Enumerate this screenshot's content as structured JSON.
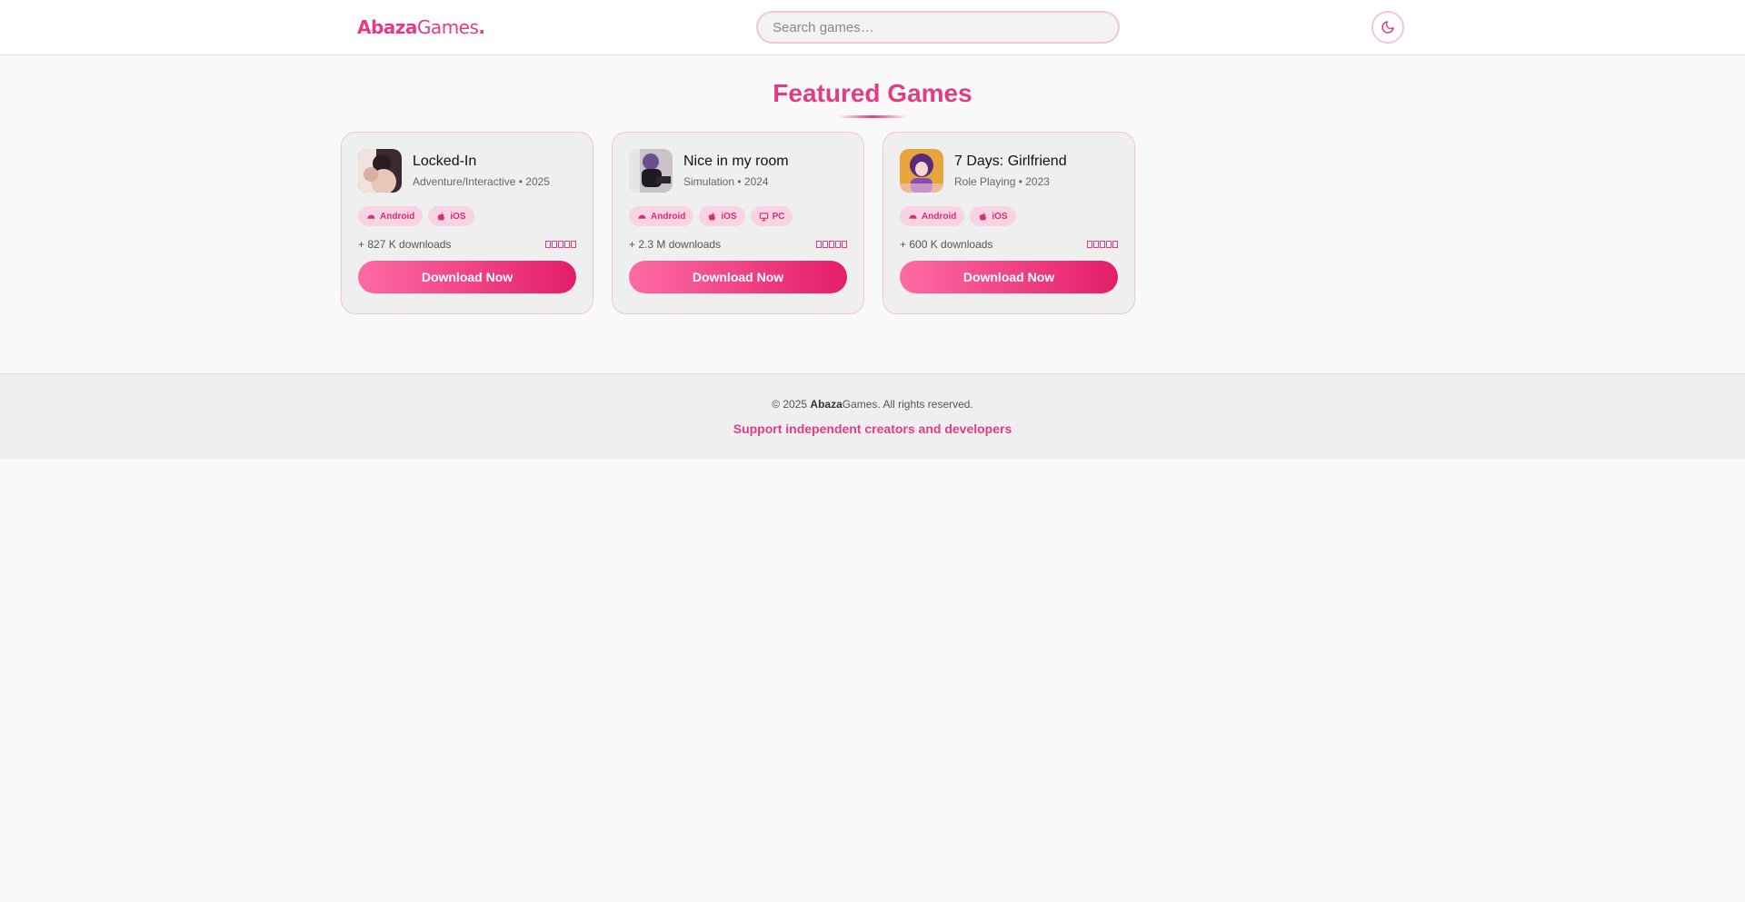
{
  "header": {
    "logo_bold": "Abaza",
    "logo_rest": "Games",
    "logo_dot": ".",
    "search_placeholder": "Search games…"
  },
  "section": {
    "title": "Featured Games"
  },
  "games": [
    {
      "title": "Locked-In",
      "meta": "Adventure/Interactive • 2025",
      "platforms": [
        "Android",
        "iOS"
      ],
      "downloads": "+ 827 K downloads",
      "button": "Download Now"
    },
    {
      "title": "Nice in my room",
      "meta": "Simulation • 2024",
      "platforms": [
        "Android",
        "iOS",
        "PC"
      ],
      "downloads": "+ 2.3 M downloads",
      "button": "Download Now"
    },
    {
      "title": "7 Days: Girlfriend",
      "meta": "Role Playing • 2023",
      "platforms": [
        "Android",
        "iOS"
      ],
      "downloads": "+ 600 K downloads",
      "button": "Download Now"
    }
  ],
  "footer": {
    "copy_prefix": "© 2025 ",
    "copy_brand_bold": "Abaza",
    "copy_brand_rest": "Games",
    "copy_suffix": ". All rights reserved.",
    "support": "Support independent creators and developers"
  },
  "colors": {
    "accent": "#e23c85",
    "button_start": "#fd6ba4",
    "button_end": "#e41e69",
    "badge_bg": "#f8d4e2"
  },
  "icons": {
    "theme_toggle": "moon-icon",
    "android": "android-icon",
    "ios": "apple-icon",
    "pc": "monitor-icon",
    "rating": "star-icon"
  }
}
